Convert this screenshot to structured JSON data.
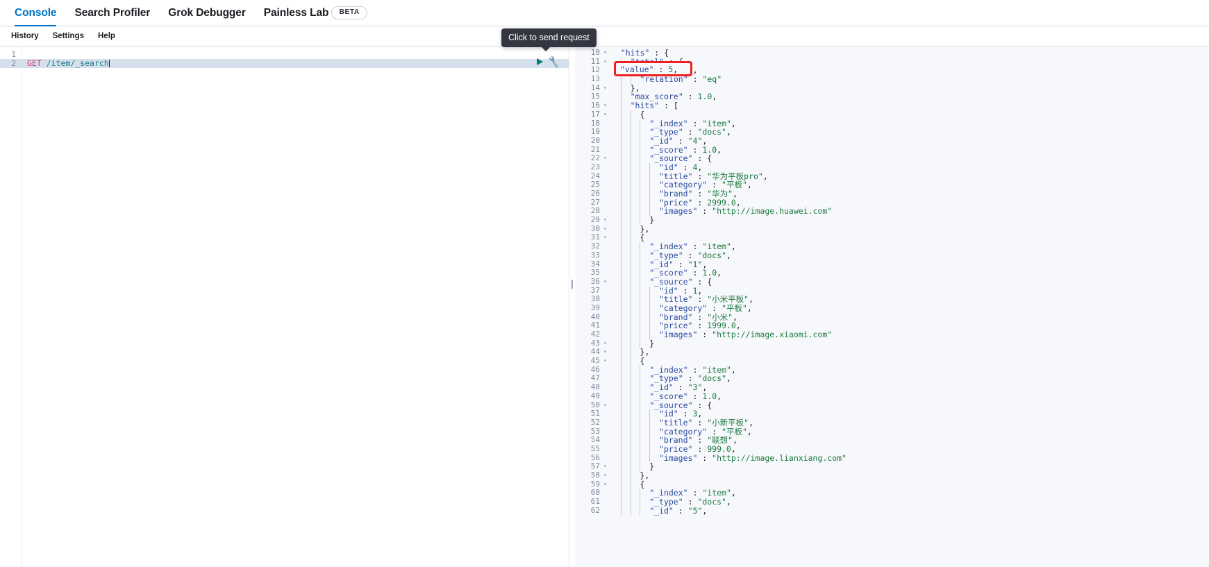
{
  "tabs": [
    {
      "label": "Console",
      "active": true,
      "badge": null
    },
    {
      "label": "Search Profiler",
      "active": false,
      "badge": null
    },
    {
      "label": "Grok Debugger",
      "active": false,
      "badge": null
    },
    {
      "label": "Painless Lab",
      "active": false,
      "badge": "BETA"
    }
  ],
  "subbar": {
    "items": [
      {
        "label": "History"
      },
      {
        "label": "Settings"
      },
      {
        "label": "Help"
      }
    ]
  },
  "tooltip": {
    "text": "Click to send request"
  },
  "actions": {
    "play_icon": "play-icon",
    "wrench_icon": "wrench-icon"
  },
  "annotation": {
    "color": "#f01e1e",
    "highlighted_line": 12,
    "highlighted_text": "\"value\" : 5,"
  },
  "request_editor": {
    "lines": [
      {
        "n": 1,
        "fold": "",
        "selected": false,
        "tokens": []
      },
      {
        "n": 2,
        "fold": "",
        "selected": true,
        "tokens": [
          {
            "t": "GET",
            "c": "k-method"
          },
          {
            "t": " ",
            "c": "k-plain"
          },
          {
            "t": "/item/_search",
            "c": "k-url"
          }
        ],
        "caret": true
      }
    ]
  },
  "response_editor": {
    "lines": [
      {
        "n": 10,
        "fold": "▾",
        "indent": 1,
        "tokens": [
          {
            "t": "\"hits\"",
            "c": "k-key"
          },
          {
            "t": " : {",
            "c": "k-punc"
          }
        ]
      },
      {
        "n": 11,
        "fold": "▾",
        "indent": 2,
        "tokens": [
          {
            "t": "\"total\"",
            "c": "k-key"
          },
          {
            "t": " : {",
            "c": "k-punc"
          }
        ]
      },
      {
        "n": 12,
        "fold": "",
        "indent": 3,
        "tokens": [
          {
            "t": "\"value\"",
            "c": "k-key"
          },
          {
            "t": " : ",
            "c": "k-punc"
          },
          {
            "t": "5",
            "c": "k-num"
          },
          {
            "t": ",",
            "c": "k-punc"
          }
        ]
      },
      {
        "n": 13,
        "fold": "",
        "indent": 3,
        "tokens": [
          {
            "t": "\"relation\"",
            "c": "k-key"
          },
          {
            "t": " : ",
            "c": "k-punc"
          },
          {
            "t": "\"eq\"",
            "c": "k-str"
          }
        ]
      },
      {
        "n": 14,
        "fold": "▾",
        "indent": 2,
        "tokens": [
          {
            "t": "},",
            "c": "k-punc"
          }
        ]
      },
      {
        "n": 15,
        "fold": "",
        "indent": 2,
        "tokens": [
          {
            "t": "\"max_score\"",
            "c": "k-key"
          },
          {
            "t": " : ",
            "c": "k-punc"
          },
          {
            "t": "1.0",
            "c": "k-num"
          },
          {
            "t": ",",
            "c": "k-punc"
          }
        ]
      },
      {
        "n": 16,
        "fold": "▾",
        "indent": 2,
        "tokens": [
          {
            "t": "\"hits\"",
            "c": "k-key"
          },
          {
            "t": " : [",
            "c": "k-punc"
          }
        ]
      },
      {
        "n": 17,
        "fold": "▾",
        "indent": 3,
        "tokens": [
          {
            "t": "{",
            "c": "k-punc"
          }
        ]
      },
      {
        "n": 18,
        "fold": "",
        "indent": 4,
        "tokens": [
          {
            "t": "\"_index\"",
            "c": "k-key"
          },
          {
            "t": " : ",
            "c": "k-punc"
          },
          {
            "t": "\"item\"",
            "c": "k-str"
          },
          {
            "t": ",",
            "c": "k-punc"
          }
        ]
      },
      {
        "n": 19,
        "fold": "",
        "indent": 4,
        "tokens": [
          {
            "t": "\"_type\"",
            "c": "k-key"
          },
          {
            "t": " : ",
            "c": "k-punc"
          },
          {
            "t": "\"docs\"",
            "c": "k-str"
          },
          {
            "t": ",",
            "c": "k-punc"
          }
        ]
      },
      {
        "n": 20,
        "fold": "",
        "indent": 4,
        "tokens": [
          {
            "t": "\"_id\"",
            "c": "k-key"
          },
          {
            "t": " : ",
            "c": "k-punc"
          },
          {
            "t": "\"4\"",
            "c": "k-str"
          },
          {
            "t": ",",
            "c": "k-punc"
          }
        ]
      },
      {
        "n": 21,
        "fold": "",
        "indent": 4,
        "tokens": [
          {
            "t": "\"_score\"",
            "c": "k-key"
          },
          {
            "t": " : ",
            "c": "k-punc"
          },
          {
            "t": "1.0",
            "c": "k-num"
          },
          {
            "t": ",",
            "c": "k-punc"
          }
        ]
      },
      {
        "n": 22,
        "fold": "▾",
        "indent": 4,
        "tokens": [
          {
            "t": "\"_source\"",
            "c": "k-key"
          },
          {
            "t": " : {",
            "c": "k-punc"
          }
        ]
      },
      {
        "n": 23,
        "fold": "",
        "indent": 5,
        "tokens": [
          {
            "t": "\"id\"",
            "c": "k-key"
          },
          {
            "t": " : ",
            "c": "k-punc"
          },
          {
            "t": "4",
            "c": "k-num"
          },
          {
            "t": ",",
            "c": "k-punc"
          }
        ]
      },
      {
        "n": 24,
        "fold": "",
        "indent": 5,
        "tokens": [
          {
            "t": "\"title\"",
            "c": "k-key"
          },
          {
            "t": " : ",
            "c": "k-punc"
          },
          {
            "t": "\"华为平板pro\"",
            "c": "k-str"
          },
          {
            "t": ",",
            "c": "k-punc"
          }
        ]
      },
      {
        "n": 25,
        "fold": "",
        "indent": 5,
        "tokens": [
          {
            "t": "\"category\"",
            "c": "k-key"
          },
          {
            "t": " : ",
            "c": "k-punc"
          },
          {
            "t": "\"平板\"",
            "c": "k-str"
          },
          {
            "t": ",",
            "c": "k-punc"
          }
        ]
      },
      {
        "n": 26,
        "fold": "",
        "indent": 5,
        "tokens": [
          {
            "t": "\"brand\"",
            "c": "k-key"
          },
          {
            "t": " : ",
            "c": "k-punc"
          },
          {
            "t": "\"华为\"",
            "c": "k-str"
          },
          {
            "t": ",",
            "c": "k-punc"
          }
        ]
      },
      {
        "n": 27,
        "fold": "",
        "indent": 5,
        "tokens": [
          {
            "t": "\"price\"",
            "c": "k-key"
          },
          {
            "t": " : ",
            "c": "k-punc"
          },
          {
            "t": "2999.0",
            "c": "k-num"
          },
          {
            "t": ",",
            "c": "k-punc"
          }
        ]
      },
      {
        "n": 28,
        "fold": "",
        "indent": 5,
        "tokens": [
          {
            "t": "\"images\"",
            "c": "k-key"
          },
          {
            "t": " : ",
            "c": "k-punc"
          },
          {
            "t": "\"http://image.huawei.com\"",
            "c": "k-str"
          }
        ]
      },
      {
        "n": 29,
        "fold": "▾",
        "indent": 4,
        "tokens": [
          {
            "t": "}",
            "c": "k-punc"
          }
        ]
      },
      {
        "n": 30,
        "fold": "▾",
        "indent": 3,
        "tokens": [
          {
            "t": "},",
            "c": "k-punc"
          }
        ]
      },
      {
        "n": 31,
        "fold": "▾",
        "indent": 3,
        "tokens": [
          {
            "t": "{",
            "c": "k-punc"
          }
        ]
      },
      {
        "n": 32,
        "fold": "",
        "indent": 4,
        "tokens": [
          {
            "t": "\"_index\"",
            "c": "k-key"
          },
          {
            "t": " : ",
            "c": "k-punc"
          },
          {
            "t": "\"item\"",
            "c": "k-str"
          },
          {
            "t": ",",
            "c": "k-punc"
          }
        ]
      },
      {
        "n": 33,
        "fold": "",
        "indent": 4,
        "tokens": [
          {
            "t": "\"_type\"",
            "c": "k-key"
          },
          {
            "t": " : ",
            "c": "k-punc"
          },
          {
            "t": "\"docs\"",
            "c": "k-str"
          },
          {
            "t": ",",
            "c": "k-punc"
          }
        ]
      },
      {
        "n": 34,
        "fold": "",
        "indent": 4,
        "tokens": [
          {
            "t": "\"_id\"",
            "c": "k-key"
          },
          {
            "t": " : ",
            "c": "k-punc"
          },
          {
            "t": "\"1\"",
            "c": "k-str"
          },
          {
            "t": ",",
            "c": "k-punc"
          }
        ]
      },
      {
        "n": 35,
        "fold": "",
        "indent": 4,
        "tokens": [
          {
            "t": "\"_score\"",
            "c": "k-key"
          },
          {
            "t": " : ",
            "c": "k-punc"
          },
          {
            "t": "1.0",
            "c": "k-num"
          },
          {
            "t": ",",
            "c": "k-punc"
          }
        ]
      },
      {
        "n": 36,
        "fold": "▾",
        "indent": 4,
        "tokens": [
          {
            "t": "\"_source\"",
            "c": "k-key"
          },
          {
            "t": " : {",
            "c": "k-punc"
          }
        ]
      },
      {
        "n": 37,
        "fold": "",
        "indent": 5,
        "tokens": [
          {
            "t": "\"id\"",
            "c": "k-key"
          },
          {
            "t": " : ",
            "c": "k-punc"
          },
          {
            "t": "1",
            "c": "k-num"
          },
          {
            "t": ",",
            "c": "k-punc"
          }
        ]
      },
      {
        "n": 38,
        "fold": "",
        "indent": 5,
        "tokens": [
          {
            "t": "\"title\"",
            "c": "k-key"
          },
          {
            "t": " : ",
            "c": "k-punc"
          },
          {
            "t": "\"小米平板\"",
            "c": "k-str"
          },
          {
            "t": ",",
            "c": "k-punc"
          }
        ]
      },
      {
        "n": 39,
        "fold": "",
        "indent": 5,
        "tokens": [
          {
            "t": "\"category\"",
            "c": "k-key"
          },
          {
            "t": " : ",
            "c": "k-punc"
          },
          {
            "t": "\"平板\"",
            "c": "k-str"
          },
          {
            "t": ",",
            "c": "k-punc"
          }
        ]
      },
      {
        "n": 40,
        "fold": "",
        "indent": 5,
        "tokens": [
          {
            "t": "\"brand\"",
            "c": "k-key"
          },
          {
            "t": " : ",
            "c": "k-punc"
          },
          {
            "t": "\"小米\"",
            "c": "k-str"
          },
          {
            "t": ",",
            "c": "k-punc"
          }
        ]
      },
      {
        "n": 41,
        "fold": "",
        "indent": 5,
        "tokens": [
          {
            "t": "\"price\"",
            "c": "k-key"
          },
          {
            "t": " : ",
            "c": "k-punc"
          },
          {
            "t": "1999.0",
            "c": "k-num"
          },
          {
            "t": ",",
            "c": "k-punc"
          }
        ]
      },
      {
        "n": 42,
        "fold": "",
        "indent": 5,
        "tokens": [
          {
            "t": "\"images\"",
            "c": "k-key"
          },
          {
            "t": " : ",
            "c": "k-punc"
          },
          {
            "t": "\"http://image.xiaomi.com\"",
            "c": "k-str"
          }
        ]
      },
      {
        "n": 43,
        "fold": "▾",
        "indent": 4,
        "tokens": [
          {
            "t": "}",
            "c": "k-punc"
          }
        ]
      },
      {
        "n": 44,
        "fold": "▾",
        "indent": 3,
        "tokens": [
          {
            "t": "},",
            "c": "k-punc"
          }
        ]
      },
      {
        "n": 45,
        "fold": "▾",
        "indent": 3,
        "tokens": [
          {
            "t": "{",
            "c": "k-punc"
          }
        ]
      },
      {
        "n": 46,
        "fold": "",
        "indent": 4,
        "tokens": [
          {
            "t": "\"_index\"",
            "c": "k-key"
          },
          {
            "t": " : ",
            "c": "k-punc"
          },
          {
            "t": "\"item\"",
            "c": "k-str"
          },
          {
            "t": ",",
            "c": "k-punc"
          }
        ]
      },
      {
        "n": 47,
        "fold": "",
        "indent": 4,
        "tokens": [
          {
            "t": "\"_type\"",
            "c": "k-key"
          },
          {
            "t": " : ",
            "c": "k-punc"
          },
          {
            "t": "\"docs\"",
            "c": "k-str"
          },
          {
            "t": ",",
            "c": "k-punc"
          }
        ]
      },
      {
        "n": 48,
        "fold": "",
        "indent": 4,
        "tokens": [
          {
            "t": "\"_id\"",
            "c": "k-key"
          },
          {
            "t": " : ",
            "c": "k-punc"
          },
          {
            "t": "\"3\"",
            "c": "k-str"
          },
          {
            "t": ",",
            "c": "k-punc"
          }
        ]
      },
      {
        "n": 49,
        "fold": "",
        "indent": 4,
        "tokens": [
          {
            "t": "\"_score\"",
            "c": "k-key"
          },
          {
            "t": " : ",
            "c": "k-punc"
          },
          {
            "t": "1.0",
            "c": "k-num"
          },
          {
            "t": ",",
            "c": "k-punc"
          }
        ]
      },
      {
        "n": 50,
        "fold": "▾",
        "indent": 4,
        "tokens": [
          {
            "t": "\"_source\"",
            "c": "k-key"
          },
          {
            "t": " : {",
            "c": "k-punc"
          }
        ]
      },
      {
        "n": 51,
        "fold": "",
        "indent": 5,
        "tokens": [
          {
            "t": "\"id\"",
            "c": "k-key"
          },
          {
            "t": " : ",
            "c": "k-punc"
          },
          {
            "t": "3",
            "c": "k-num"
          },
          {
            "t": ",",
            "c": "k-punc"
          }
        ]
      },
      {
        "n": 52,
        "fold": "",
        "indent": 5,
        "tokens": [
          {
            "t": "\"title\"",
            "c": "k-key"
          },
          {
            "t": " : ",
            "c": "k-punc"
          },
          {
            "t": "\"小新平板\"",
            "c": "k-str"
          },
          {
            "t": ",",
            "c": "k-punc"
          }
        ]
      },
      {
        "n": 53,
        "fold": "",
        "indent": 5,
        "tokens": [
          {
            "t": "\"category\"",
            "c": "k-key"
          },
          {
            "t": " : ",
            "c": "k-punc"
          },
          {
            "t": "\"平板\"",
            "c": "k-str"
          },
          {
            "t": ",",
            "c": "k-punc"
          }
        ]
      },
      {
        "n": 54,
        "fold": "",
        "indent": 5,
        "tokens": [
          {
            "t": "\"brand\"",
            "c": "k-key"
          },
          {
            "t": " : ",
            "c": "k-punc"
          },
          {
            "t": "\"联想\"",
            "c": "k-str"
          },
          {
            "t": ",",
            "c": "k-punc"
          }
        ]
      },
      {
        "n": 55,
        "fold": "",
        "indent": 5,
        "tokens": [
          {
            "t": "\"price\"",
            "c": "k-key"
          },
          {
            "t": " : ",
            "c": "k-punc"
          },
          {
            "t": "999.0",
            "c": "k-num"
          },
          {
            "t": ",",
            "c": "k-punc"
          }
        ]
      },
      {
        "n": 56,
        "fold": "",
        "indent": 5,
        "tokens": [
          {
            "t": "\"images\"",
            "c": "k-key"
          },
          {
            "t": " : ",
            "c": "k-punc"
          },
          {
            "t": "\"http://image.lianxiang.com\"",
            "c": "k-str"
          }
        ]
      },
      {
        "n": 57,
        "fold": "▾",
        "indent": 4,
        "tokens": [
          {
            "t": "}",
            "c": "k-punc"
          }
        ]
      },
      {
        "n": 58,
        "fold": "▾",
        "indent": 3,
        "tokens": [
          {
            "t": "},",
            "c": "k-punc"
          }
        ]
      },
      {
        "n": 59,
        "fold": "▾",
        "indent": 3,
        "tokens": [
          {
            "t": "{",
            "c": "k-punc"
          }
        ]
      },
      {
        "n": 60,
        "fold": "",
        "indent": 4,
        "tokens": [
          {
            "t": "\"_index\"",
            "c": "k-key"
          },
          {
            "t": " : ",
            "c": "k-punc"
          },
          {
            "t": "\"item\"",
            "c": "k-str"
          },
          {
            "t": ",",
            "c": "k-punc"
          }
        ]
      },
      {
        "n": 61,
        "fold": "",
        "indent": 4,
        "tokens": [
          {
            "t": "\"_type\"",
            "c": "k-key"
          },
          {
            "t": " : ",
            "c": "k-punc"
          },
          {
            "t": "\"docs\"",
            "c": "k-str"
          },
          {
            "t": ",",
            "c": "k-punc"
          }
        ]
      },
      {
        "n": 62,
        "fold": "",
        "indent": 4,
        "tokens": [
          {
            "t": "\"_id\"",
            "c": "k-key"
          },
          {
            "t": " : ",
            "c": "k-punc"
          },
          {
            "t": "\"5\"",
            "c": "k-str"
          },
          {
            "t": ",",
            "c": "k-punc"
          }
        ]
      }
    ]
  }
}
